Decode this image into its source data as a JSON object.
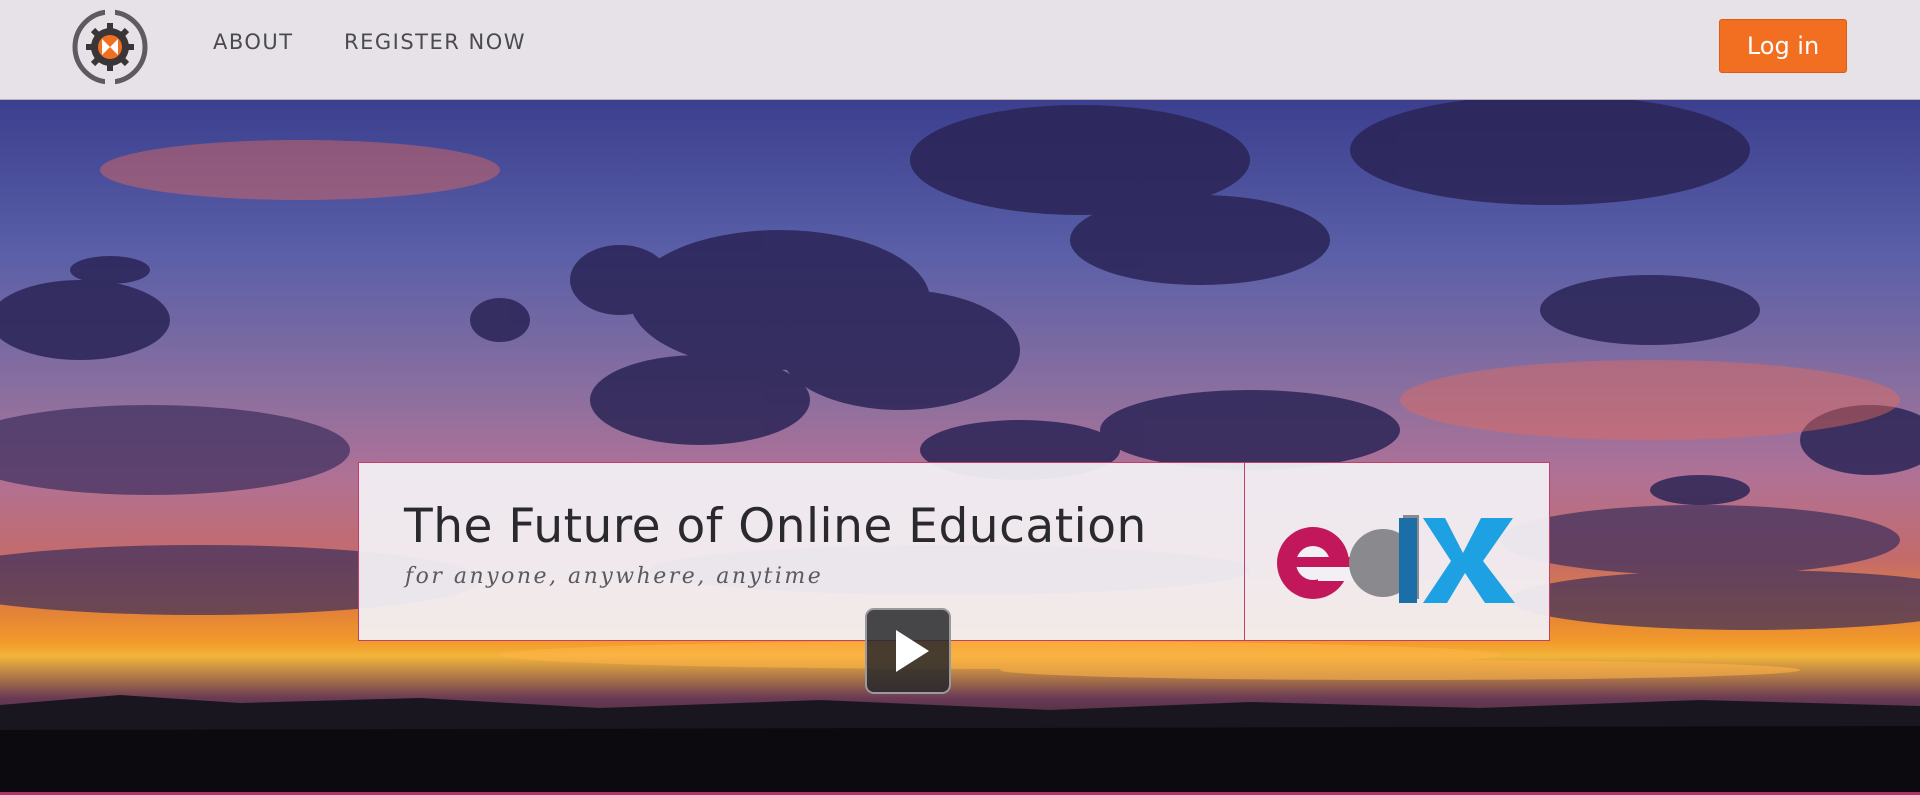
{
  "nav": {
    "about_label": "ABOUT",
    "register_label": "REGISTER NOW",
    "login_label": "Log in"
  },
  "hero": {
    "headline": "The Future of Online Education",
    "tagline": "for anyone, anywhere, anytime"
  },
  "icons": {
    "logo": "gear-logo-icon",
    "video": "edx-video-thumbnail",
    "play": "play-icon"
  },
  "colors": {
    "accent": "#f26f21",
    "banner_border": "#c23f6c",
    "edx_magenta": "#c2185b",
    "edx_blue": "#1da1e2"
  }
}
